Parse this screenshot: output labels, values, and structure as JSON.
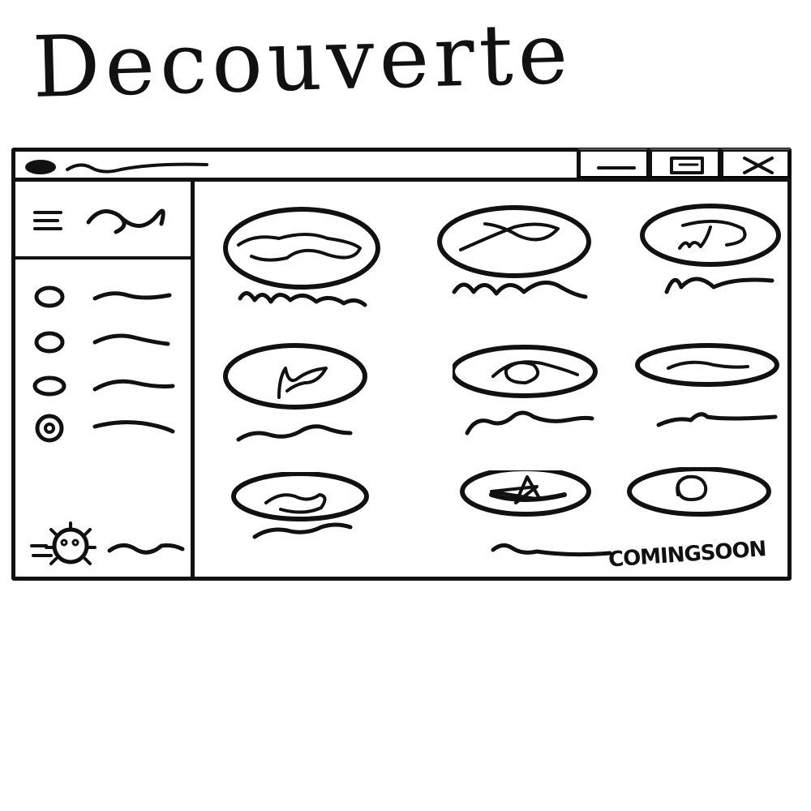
{
  "app": {
    "title": "Decouverte"
  },
  "window_controls": {
    "minimize_icon": "minimize-icon",
    "maximize_icon": "maximize-icon",
    "close_icon": "close-icon"
  },
  "sidebar": {
    "menu_icon": "hamburger-icon",
    "items": [
      {
        "icon": "circle-icon"
      },
      {
        "icon": "circle-icon"
      },
      {
        "icon": "circle-icon"
      },
      {
        "icon": "circle-icon"
      }
    ],
    "user": {
      "icon": "avatar-icon"
    }
  },
  "grid": {
    "cards": [
      {
        "thumbnail": "oval-thumbnail"
      },
      {
        "thumbnail": "oval-thumbnail"
      },
      {
        "thumbnail": "oval-thumbnail"
      },
      {
        "thumbnail": "oval-thumbnail"
      },
      {
        "thumbnail": "oval-thumbnail"
      },
      {
        "thumbnail": "oval-thumbnail"
      },
      {
        "thumbnail": "oval-thumbnail"
      },
      {
        "thumbnail": "oval-thumbnail"
      },
      {
        "thumbnail": "oval-thumbnail"
      }
    ],
    "coming_soon": "COMINGSOON"
  }
}
